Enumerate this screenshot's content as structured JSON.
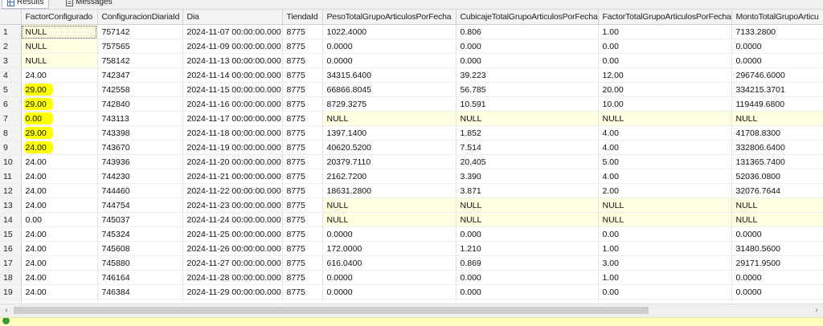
{
  "tabs": [
    {
      "label": "Results",
      "active": true,
      "icon": "grid-icon"
    },
    {
      "label": "Messages",
      "active": false,
      "icon": "messages-icon"
    }
  ],
  "grid": {
    "columns": [
      "",
      "FactorConfigurado",
      "ConfiguracionDiariaId",
      "Dia",
      "TiendaId",
      "PesoTotalGrupoArticulosPorFecha",
      "CubicajeTotalGrupoArticulosPorFecha",
      "FactorTotalGrupoArticulosPorFecha",
      "MontoTotalGrupoArticu"
    ],
    "rows": [
      [
        "1",
        "NULL",
        "757142",
        "2024-11-07 00:00:00.000",
        "8775",
        "1022.4000",
        "0.806",
        "1.00",
        "7133.2800"
      ],
      [
        "2",
        "NULL",
        "757565",
        "2024-11-09 00:00:00.000",
        "8775",
        "0.0000",
        "0.000",
        "0.00",
        "0.0000"
      ],
      [
        "3",
        "NULL",
        "758142",
        "2024-11-13 00:00:00.000",
        "8775",
        "0.0000",
        "0.000",
        "0.00",
        "0.0000"
      ],
      [
        "4",
        "24.00",
        "742347",
        "2024-11-14 00:00:00.000",
        "8775",
        "34315.6400",
        "39.223",
        "12.00",
        "296746.6000"
      ],
      [
        "5",
        "29.00",
        "742558",
        "2024-11-15 00:00:00.000",
        "8775",
        "66866.8045",
        "56.785",
        "20.00",
        "334215.3701"
      ],
      [
        "6",
        "29.00",
        "742840",
        "2024-11-16 00:00:00.000",
        "8775",
        "8729.3275",
        "10.591",
        "10.00",
        "119449.6800"
      ],
      [
        "7",
        "0.00",
        "743113",
        "2024-11-17 00:00:00.000",
        "8775",
        "NULL",
        "NULL",
        "NULL",
        "NULL"
      ],
      [
        "8",
        "29.00",
        "743398",
        "2024-11-18 00:00:00.000",
        "8775",
        "1397.1400",
        "1.852",
        "4.00",
        "41708.8300"
      ],
      [
        "9",
        "24.00",
        "743670",
        "2024-11-19 00:00:00.000",
        "8775",
        "40620.5200",
        "7.514",
        "4.00",
        "332806.6400"
      ],
      [
        "10",
        "24.00",
        "743936",
        "2024-11-20 00:00:00.000",
        "8775",
        "20379.7110",
        "20.405",
        "5.00",
        "131365.7400"
      ],
      [
        "11",
        "24.00",
        "744230",
        "2024-11-21 00:00:00.000",
        "8775",
        "2162.7200",
        "3.390",
        "4.00",
        "52036.0800"
      ],
      [
        "12",
        "24.00",
        "744460",
        "2024-11-22 00:00:00.000",
        "8775",
        "18631.2800",
        "3.871",
        "2.00",
        "32076.7644"
      ],
      [
        "13",
        "24.00",
        "744754",
        "2024-11-23 00:00:00.000",
        "8775",
        "NULL",
        "NULL",
        "NULL",
        "NULL"
      ],
      [
        "14",
        "0.00",
        "745037",
        "2024-11-24 00:00:00.000",
        "8775",
        "NULL",
        "NULL",
        "NULL",
        "NULL"
      ],
      [
        "15",
        "24.00",
        "745324",
        "2024-11-25 00:00:00.000",
        "8775",
        "0.0000",
        "0.000",
        "0.00",
        "0.0000"
      ],
      [
        "16",
        "24.00",
        "745608",
        "2024-11-26 00:00:00.000",
        "8775",
        "172.0000",
        "1.210",
        "1.00",
        "31480.5600"
      ],
      [
        "17",
        "24.00",
        "745880",
        "2024-11-27 00:00:00.000",
        "8775",
        "616.0400",
        "0.869",
        "3.00",
        "29171.9500"
      ],
      [
        "18",
        "24.00",
        "746164",
        "2024-11-28 00:00:00.000",
        "8775",
        "0.0000",
        "0.000",
        "1.00",
        "0.0000"
      ],
      [
        "19",
        "24.00",
        "746384",
        "2024-11-29 00:00:00.000",
        "8775",
        "0.0000",
        "0.000",
        "0.00",
        "0.0000"
      ],
      [
        "20",
        "24.00",
        "746669",
        "2024-11-30 00:00:00.000",
        "8775",
        "0.0000",
        "0.000",
        "0.00",
        "0.0000"
      ]
    ],
    "highlighted_rows": [
      5,
      6,
      7,
      8,
      9
    ],
    "selected_cell": {
      "row": 1,
      "col": 1
    }
  },
  "scrollbar": {
    "left_arrow": "‹",
    "right_arrow": "›"
  },
  "colors": {
    "null_cell": "#ffffe1",
    "highlight": "#ffff00",
    "status_bar": "#ffffc0"
  }
}
